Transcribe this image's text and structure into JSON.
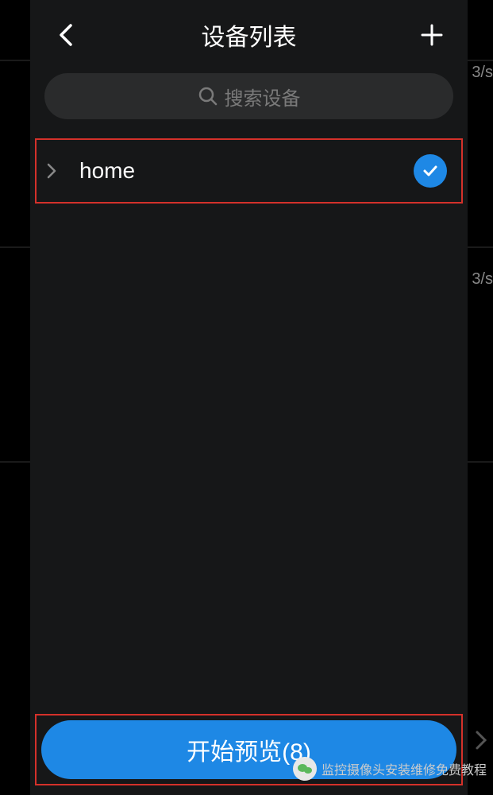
{
  "header": {
    "title": "设备列表"
  },
  "search": {
    "placeholder": "搜索设备"
  },
  "devices": [
    {
      "name": "home",
      "selected": true
    }
  ],
  "preview": {
    "label": "开始预览(8)"
  },
  "background": {
    "rate_suffix": "3/s"
  },
  "watermark": {
    "text": "监控摄像头安装维修免费教程"
  }
}
